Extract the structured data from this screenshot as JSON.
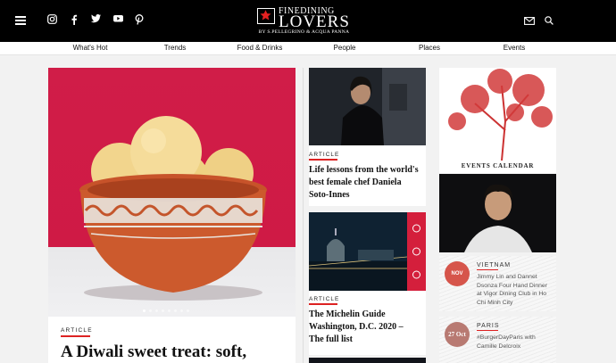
{
  "header": {
    "logo_top": "FINEDINING",
    "logo_main": "LOVERS",
    "logo_by": "BY S.PELLEGRINO & ACQUA PANNA"
  },
  "social_icons": [
    "instagram-icon",
    "facebook-icon",
    "twitter-icon",
    "youtube-icon",
    "pinterest-icon"
  ],
  "nav": {
    "items": [
      "What's Hot",
      "Trends",
      "Food & Drinks",
      "People",
      "Places",
      "Events"
    ]
  },
  "hero": {
    "tag": "ARTICLE",
    "title": "A Diwali sweet treat: soft,",
    "slides": 8,
    "active_slide": 1
  },
  "middle": {
    "cards": [
      {
        "tag": "ARTICLE",
        "title": "Life lessons from the world's best female chef Daniela Soto-Innes"
      },
      {
        "tag": "ARTICLE",
        "title": "The Michelin Guide Washington, D.C. 2020 – The full list"
      }
    ]
  },
  "right": {
    "events_label": "EVENTS CALENDAR",
    "events": [
      {
        "city": "VIETNAM",
        "icon": "vietnam-date-icon",
        "date_text": "NOV",
        "text": "Jimmy Lin and Dannet Dsonza Four Hand Dinner at Vigor Dining Club in Ho Chi Minh City"
      },
      {
        "city": "PARIS",
        "icon": "paris-date-icon",
        "date_text": "27 Oct",
        "text": "#BurgerDayParis with Camille Delcroix"
      }
    ]
  },
  "colors": {
    "accent": "#d22222",
    "header_bg": "#000000",
    "hero_bg": "#d01d48"
  }
}
